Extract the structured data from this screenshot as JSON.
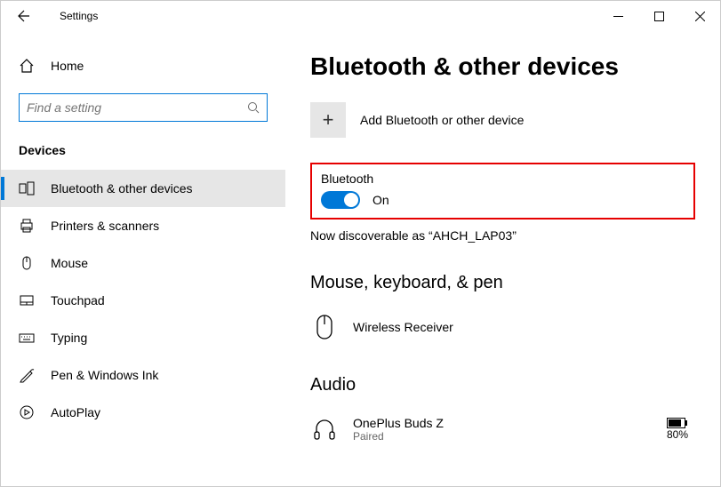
{
  "window": {
    "title": "Settings"
  },
  "sidebar": {
    "home": "Home",
    "search_placeholder": "Find a setting",
    "section": "Devices",
    "items": [
      {
        "label": "Bluetooth & other devices",
        "icon": "bluetooth-devices-icon"
      },
      {
        "label": "Printers & scanners",
        "icon": "printer-icon"
      },
      {
        "label": "Mouse",
        "icon": "mouse-icon"
      },
      {
        "label": "Touchpad",
        "icon": "touchpad-icon"
      },
      {
        "label": "Typing",
        "icon": "keyboard-icon"
      },
      {
        "label": "Pen & Windows Ink",
        "icon": "pen-icon"
      },
      {
        "label": "AutoPlay",
        "icon": "autoplay-icon"
      }
    ]
  },
  "content": {
    "heading": "Bluetooth & other devices",
    "add_label": "Add Bluetooth or other device",
    "bluetooth": {
      "label": "Bluetooth",
      "state": "On",
      "discoverable": "Now discoverable as “AHCH_LAP03”"
    },
    "groups": {
      "mkp": {
        "heading": "Mouse, keyboard, & pen",
        "devices": [
          {
            "name": "Wireless Receiver"
          }
        ]
      },
      "audio": {
        "heading": "Audio",
        "devices": [
          {
            "name": "OnePlus Buds Z",
            "status": "Paired",
            "battery": "80%"
          }
        ]
      }
    }
  }
}
